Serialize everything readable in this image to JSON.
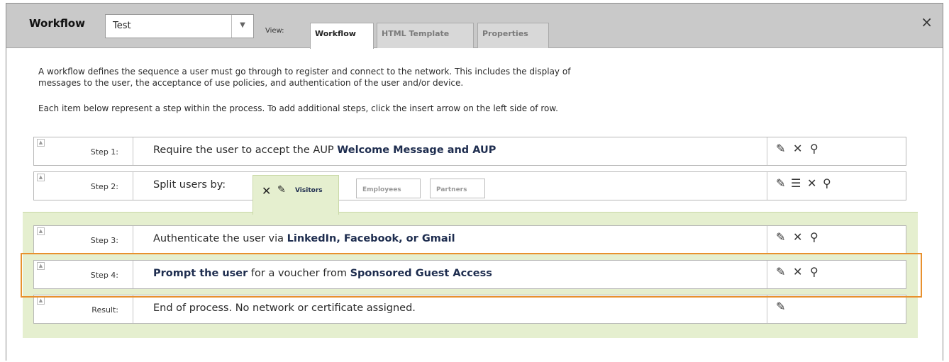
{
  "header": {
    "title": "Workflow",
    "select_value": "Test",
    "view_label": "View:",
    "tabs": [
      {
        "label": "Workflow"
      },
      {
        "label": "HTML Template"
      },
      {
        "label": "Properties"
      }
    ],
    "close": "×"
  },
  "description": {
    "line1": "A workflow defines the sequence a user must go through to register and connect to the network. This includes the display of",
    "line2": "messages to the user, the acceptance of use policies, and authentication of the user and/or device.",
    "line3": "Each item below represent a step within the process. To add additional steps, click the insert arrow on the left side of row."
  },
  "steps": [
    {
      "label": "Step 1:",
      "text": "Require the user to accept the AUP ",
      "bold": "Welcome Message and AUP"
    },
    {
      "label": "Step 2:",
      "text": "Split users by:"
    },
    {
      "label": "Step 3:",
      "text": "Authenticate the user via ",
      "bold": "LinkedIn, Facebook, or Gmail"
    },
    {
      "label": "Step 4:",
      "bold_pre": "Prompt the user",
      "text": " for a voucher from ",
      "bold": "Sponsored Guest Access"
    },
    {
      "label": "Result:",
      "text": "End of process. No network or certificate assigned."
    }
  ],
  "split_tabs": [
    {
      "label": "Visitors"
    },
    {
      "label": "Employees"
    },
    {
      "label": "Partners"
    }
  ],
  "icons": {
    "edit": "pencil-icon",
    "delete": "close-icon",
    "search": "magnifier-icon",
    "list": "list-icon"
  },
  "colors": {
    "highlight": "#e8912e",
    "branch_bg": "#e5efcf",
    "link_text": "#1e2d4f"
  }
}
